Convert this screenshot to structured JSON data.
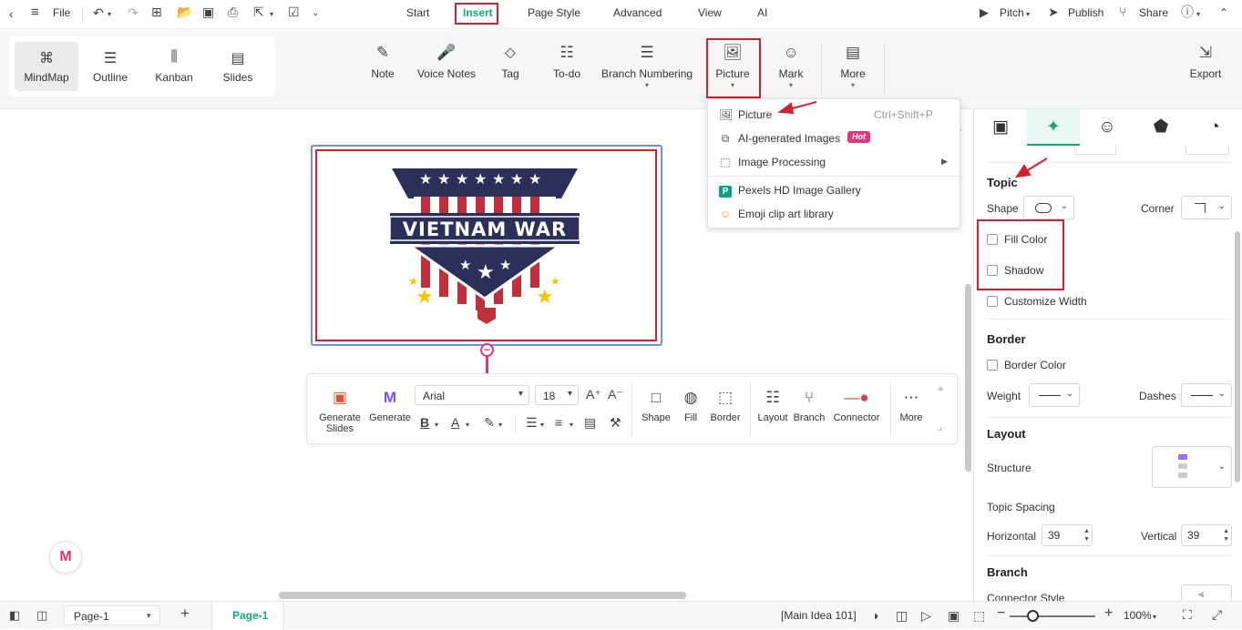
{
  "menubar": {
    "file": "File",
    "tabs": [
      "Start",
      "Insert",
      "Page Style",
      "Advanced",
      "View",
      "AI"
    ],
    "pitch": "Pitch",
    "publish": "Publish",
    "share": "Share"
  },
  "views": [
    "MindMap",
    "Outline",
    "Kanban",
    "Slides"
  ],
  "ribbon": {
    "note": "Note",
    "voice_notes": "Voice Notes",
    "tag": "Tag",
    "todo": "To-do",
    "branch_numbering": "Branch Numbering",
    "picture": "Picture",
    "mark": "Mark",
    "more": "More",
    "export": "Export"
  },
  "picture_menu": {
    "picture": "Picture",
    "picture_shortcut": "Ctrl+Shift+P",
    "ai_images": "AI-generated Images",
    "hot_badge": "Hot",
    "image_processing": "Image Processing",
    "pexels": "Pexels HD Image Gallery",
    "emoji": "Emoji clip art library"
  },
  "topic_image": {
    "text": "VIETNAM WAR"
  },
  "float_toolbar": {
    "generate_slides": "Generate Slides",
    "generate": "Generate",
    "font": "Arial",
    "font_size": "18",
    "shape": "Shape",
    "fill": "Fill",
    "border": "Border",
    "layout": "Layout",
    "branch": "Branch",
    "connector": "Connector",
    "more": "More"
  },
  "panel": {
    "topic_heading": "Topic",
    "shape_label": "Shape",
    "corner_label": "Corner",
    "fill_color": "Fill Color",
    "shadow": "Shadow",
    "customize_width": "Customize Width",
    "border_heading": "Border",
    "border_color": "Border Color",
    "weight_label": "Weight",
    "dashes_label": "Dashes",
    "layout_heading": "Layout",
    "structure_label": "Structure",
    "topic_spacing": "Topic Spacing",
    "horizontal_label": "Horizontal",
    "horizontal_value": "39",
    "vertical_label": "Vertical",
    "vertical_value": "39",
    "branch_heading": "Branch",
    "connector_style": "Connector Style"
  },
  "statusbar": {
    "page_select": "Page-1",
    "page_tab": "Page-1",
    "selection": "[Main Idea 101]",
    "zoom": "100%"
  },
  "colors": {
    "accent_green": "#17a77a",
    "highlight_red": "#d2202f",
    "flag_navy": "#2b2f5a",
    "flag_red": "#c0303a",
    "star_gold": "#f2c500"
  }
}
